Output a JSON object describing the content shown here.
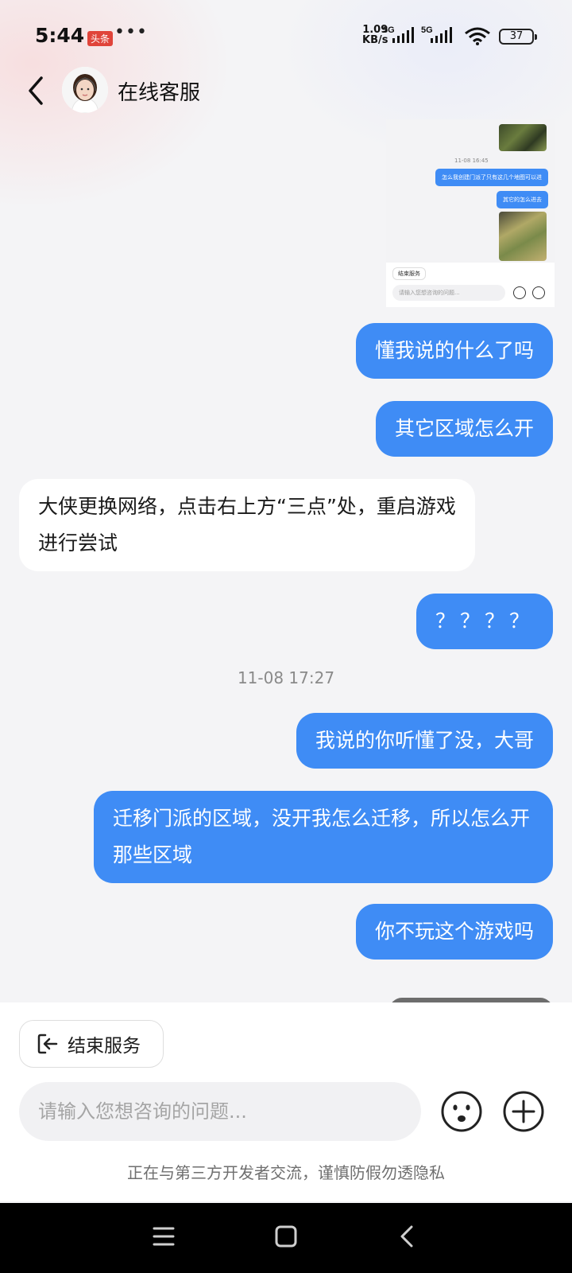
{
  "status_bar": {
    "time": "5:44",
    "news_badge": "头条",
    "more": "•••",
    "net_speed_value": "1.09",
    "net_speed_unit": "KB/s",
    "network_1": "5G",
    "network_2": "5G",
    "battery": "37"
  },
  "header": {
    "title": "在线客服"
  },
  "chat": {
    "screenshot_card": {
      "time": "11-08 16:45",
      "bubble_1": "怎么我创建门派了只有这几个地图可以进",
      "bubble_2": "其它的怎么进去",
      "end_label": "结束服务",
      "input_placeholder": "请输入您想咨询的问题..."
    },
    "messages": [
      {
        "side": "me",
        "text": "懂我说的什么了吗"
      },
      {
        "side": "me",
        "text": "其它区域怎么开"
      },
      {
        "side": "other",
        "text": "大侠更换网络，点击右上方“三点”处，重启游戏进行尝试"
      },
      {
        "side": "me",
        "text": "？？？？"
      },
      {
        "side": "me",
        "text": "我说的你听懂了没，大哥"
      },
      {
        "side": "me",
        "text": "迁移门派的区域，没开我怎么迁移，所以怎么开那些区域"
      },
      {
        "side": "me",
        "text": "你不玩这个游戏吗"
      }
    ],
    "timestamp": "11-08 17:27"
  },
  "input_area": {
    "end_service_label": "结束服务",
    "placeholder": "请输入您想咨询的问题...",
    "disclaimer": "正在与第三方开发者交流，谨慎防假勿透隐私"
  },
  "colors": {
    "accent": "#3f8cf5",
    "background": "#f4f4f6"
  },
  "icons": {
    "back": "chevron-left-icon",
    "emoji": "smiley-icon",
    "plus": "plus-circle-icon",
    "end_service": "exit-icon"
  }
}
